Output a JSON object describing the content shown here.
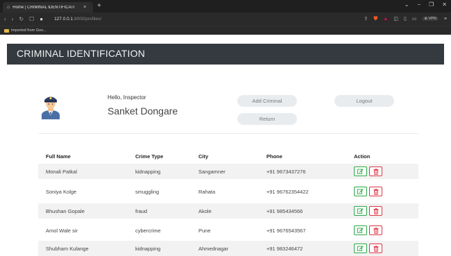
{
  "browser": {
    "tab_title": "Home | CRIMINAL IDENTIFICATI",
    "tab_close": "×",
    "new_tab": "+",
    "url_host": "127.0.0.1",
    "url_path": ":8000/profiles/",
    "vpn_label": "VPN",
    "bookmark_label": "Imported from Goo...",
    "window_min": "−",
    "window_max": "❐",
    "window_close": "✕",
    "window_menu": "⌄"
  },
  "app": {
    "brand": "CRIMINAL IDENTIFICATION"
  },
  "profile": {
    "greeting": "Hello, Inspector",
    "name": "Sanket Dongare",
    "add_label": "Add Criminal",
    "return_label": "Return",
    "logout_label": "Logout"
  },
  "table": {
    "headers": {
      "name": "Full Name",
      "crime": "Crime Type",
      "city": "City",
      "phone": "Phone",
      "action": "Action"
    },
    "rows": [
      {
        "name": "Monali Patkal",
        "crime": "kidnapping",
        "city": "Sangamner",
        "phone": "+91 9673437276"
      },
      {
        "name": "Soniya Kolge",
        "crime": "smuggling",
        "city": "Rahata",
        "phone": "+91 96762354422"
      },
      {
        "name": "Bhushan Gopale",
        "crime": "fraud",
        "city": "Akole",
        "phone": "+91 985434566"
      },
      {
        "name": "Amol Wale sir",
        "crime": "cybercrime",
        "city": "Pune",
        "phone": "+91 9676543567"
      },
      {
        "name": "Shubham Kulange",
        "crime": "kidnapping",
        "city": "Ahmednagar",
        "phone": "+91 983246472"
      }
    ]
  },
  "colors": {
    "header_bg": "#343a40",
    "edit": "#28a745",
    "delete": "#dc3545"
  },
  "icons": {
    "edit": "edit-icon",
    "delete": "trash-icon"
  }
}
